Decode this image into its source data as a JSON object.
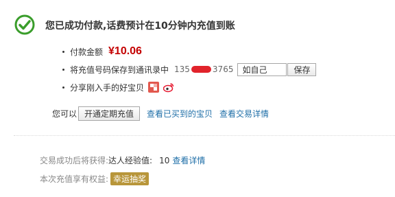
{
  "header": {
    "title": "您已成功付款,话费预计在10分钟内充值到账",
    "accent_color": "#3a9d2b"
  },
  "details": {
    "amount_label": "付款金额",
    "amount_value": "¥10.06",
    "save_contact_label": "将充值号码保存到通讯录中",
    "phone_prefix": "135",
    "phone_suffix": "3765",
    "name_input_value": "如自己",
    "save_button": "保存",
    "share_label": "分享刚入手的好宝贝",
    "share_icons": [
      "share-qzone-icon",
      "weibo-icon"
    ]
  },
  "actions": {
    "prefix": "您可以",
    "periodic_button": "开通定期充值",
    "view_purchased_link": "查看已买到的宝贝",
    "view_detail_link": "查看交易详情"
  },
  "rewards": {
    "gain_label": "交易成功后将获得:",
    "exp_label": "达人经验值:",
    "exp_value": "10",
    "exp_link": "查看详情",
    "rights_label": "本次充值享有权益:",
    "lottery_badge": "幸运抽奖"
  }
}
